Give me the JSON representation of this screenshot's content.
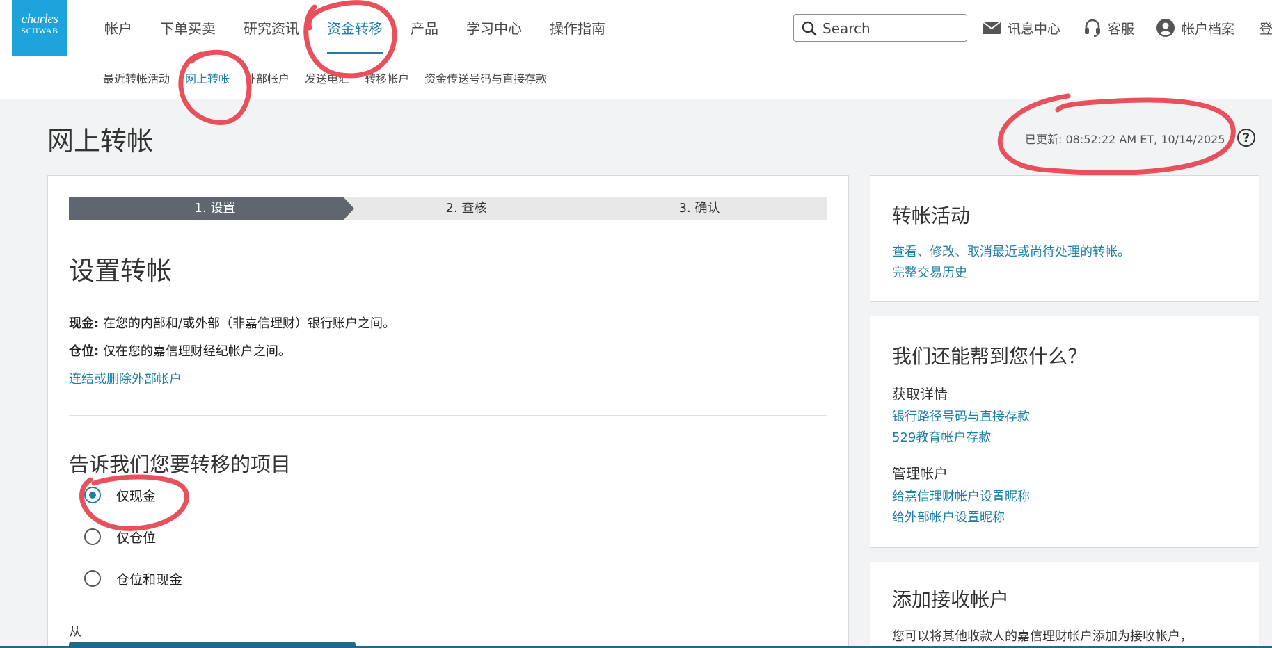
{
  "brand": {
    "line1": "charles",
    "line2": "SCHWAB"
  },
  "main_nav": [
    "帐户",
    "下单买卖",
    "研究资讯",
    "资金转移",
    "产品",
    "学习中心",
    "操作指南"
  ],
  "main_nav_active": "资金转移",
  "search": {
    "placeholder": "Search"
  },
  "utility": {
    "messages": "讯息中心",
    "service": "客服",
    "profile": "帐户档案",
    "login": "登"
  },
  "sub_nav": [
    "最近转帐活动",
    "网上转帐",
    "外部帐户",
    "发送电汇",
    "转移帐户",
    "资金传送号码与直接存款"
  ],
  "sub_nav_active": "网上转帐",
  "page": {
    "title": "网上转帐",
    "updated": "已更新: 08:52:22 AM ET, 10/14/2025",
    "help": "?"
  },
  "steps": [
    "1. 设置",
    "2. 查核",
    "3. 确认"
  ],
  "setup": {
    "title": "设置转帐",
    "cash_label": "现金:",
    "cash_text": "在您的内部和/或外部（非嘉信理财）银行账户之间。",
    "position_label": "仓位:",
    "position_text": "仅在您的嘉信理财经纪帐户之间。",
    "external_link": "连结或删除外部帐户",
    "question": "告诉我们您要转移的项目",
    "options": [
      "仅现金",
      "仅仓位",
      "仓位和现金"
    ],
    "selected": 0,
    "from_label": "从"
  },
  "transfer_activity": {
    "title": "转帐活动",
    "link1": "查看、修改、取消最近或尚待处理的转帐。",
    "link2": "完整交易历史"
  },
  "help_card": {
    "title": "我们还能帮到您什么？",
    "group1_title": "获取详情",
    "group1_links": [
      "银行路径号码与直接存款",
      "529教育帐户存款"
    ],
    "group2_title": "管理帐户",
    "group2_links": [
      "给嘉信理财帐户设置昵称",
      "给外部帐户设置昵称"
    ]
  },
  "add_recipient": {
    "title": "添加接收帐户",
    "text": "您可以将其他收款人的嘉信理财帐户添加为接收帐户，"
  },
  "colors": {
    "accent": "#1d7fa6",
    "brand": "#1ea3dd",
    "annotation": "#e8505b",
    "step_active": "#5f6670"
  }
}
